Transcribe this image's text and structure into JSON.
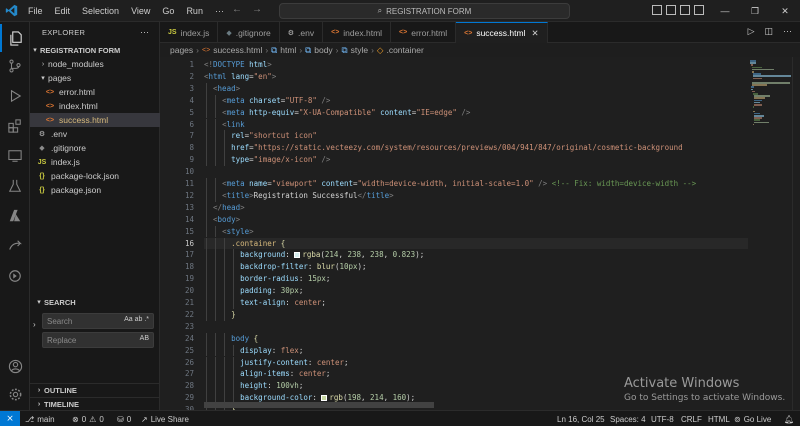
{
  "titlebar": {
    "menu": [
      "File",
      "Edit",
      "Selection",
      "View",
      "Go",
      "Run"
    ],
    "more": "···",
    "search_text": "REGISTRATION FORM"
  },
  "sidebar": {
    "explorer_label": "EXPLORER",
    "more": "···",
    "project_name": "REGISTRATION FORM",
    "tree": [
      {
        "label": "node_modules",
        "type": "folder",
        "collapsed": true
      },
      {
        "label": "pages",
        "type": "folder",
        "collapsed": false
      },
      {
        "label": "error.html",
        "type": "html"
      },
      {
        "label": "index.html",
        "type": "html"
      },
      {
        "label": "success.html",
        "type": "html",
        "selected": true
      },
      {
        "label": ".env",
        "type": "env"
      },
      {
        "label": ".gitignore",
        "type": "git"
      },
      {
        "label": "index.js",
        "type": "js",
        "icon": "JS"
      },
      {
        "label": "package-lock.json",
        "type": "json",
        "icon": "{}"
      },
      {
        "label": "package.json",
        "type": "json",
        "icon": "{}"
      }
    ],
    "search_label": "SEARCH",
    "search_placeholder": "Search",
    "search_opts": "Aa ab .*",
    "replace_placeholder": "Replace",
    "replace_opts": "AB",
    "outline_label": "OUTLINE",
    "timeline_label": "TIMELINE"
  },
  "tabs": [
    {
      "label": "index.js",
      "icon": "JS",
      "color": "#cbcb41"
    },
    {
      "label": ".gitignore",
      "icon": "◆",
      "color": "#41535b"
    },
    {
      "label": ".env",
      "icon": "⚙",
      "color": "#c5c5c5"
    },
    {
      "label": "index.html",
      "icon": "<>",
      "color": "#e37933"
    },
    {
      "label": "error.html",
      "icon": "<>",
      "color": "#e37933"
    },
    {
      "label": "success.html",
      "icon": "<>",
      "color": "#e37933",
      "active": true
    }
  ],
  "breadcrumb": [
    "pages",
    "success.html",
    "html",
    "body",
    "style",
    ".container"
  ],
  "editor": {
    "current_line": 16,
    "lines": [
      {
        "n": 1,
        "indent": 0,
        "parts": [
          [
            "pun",
            "<!"
          ],
          [
            "tag",
            "DOCTYPE"
          ],
          [
            "txt",
            " "
          ],
          [
            "attr",
            "html"
          ],
          [
            "pun",
            ">"
          ]
        ]
      },
      {
        "n": 2,
        "indent": 0,
        "parts": [
          [
            "pun",
            "<"
          ],
          [
            "tag",
            "html"
          ],
          [
            "txt",
            " "
          ],
          [
            "attr",
            "lang"
          ],
          [
            "txt",
            "="
          ],
          [
            "str",
            "\"en\""
          ],
          [
            "pun",
            ">"
          ]
        ]
      },
      {
        "n": 3,
        "indent": 2,
        "parts": [
          [
            "pun",
            "<"
          ],
          [
            "tag",
            "head"
          ],
          [
            "pun",
            ">"
          ]
        ]
      },
      {
        "n": 4,
        "indent": 4,
        "parts": [
          [
            "pun",
            "<"
          ],
          [
            "tag",
            "meta"
          ],
          [
            "txt",
            " "
          ],
          [
            "attr",
            "charset"
          ],
          [
            "txt",
            "="
          ],
          [
            "str",
            "\"UTF-8\""
          ],
          [
            "txt",
            " "
          ],
          [
            "pun",
            "/>"
          ]
        ]
      },
      {
        "n": 5,
        "indent": 4,
        "parts": [
          [
            "pun",
            "<"
          ],
          [
            "tag",
            "meta"
          ],
          [
            "txt",
            " "
          ],
          [
            "attr",
            "http-equiv"
          ],
          [
            "txt",
            "="
          ],
          [
            "str",
            "\"X-UA-Compatible\""
          ],
          [
            "txt",
            " "
          ],
          [
            "attr",
            "content"
          ],
          [
            "txt",
            "="
          ],
          [
            "str",
            "\"IE=edge\""
          ],
          [
            "txt",
            " "
          ],
          [
            "pun",
            "/>"
          ]
        ]
      },
      {
        "n": 6,
        "indent": 4,
        "parts": [
          [
            "pun",
            "<"
          ],
          [
            "tag",
            "link"
          ]
        ]
      },
      {
        "n": 7,
        "indent": 6,
        "parts": [
          [
            "attr",
            "rel"
          ],
          [
            "txt",
            "="
          ],
          [
            "str",
            "\"shortcut icon\""
          ]
        ]
      },
      {
        "n": 8,
        "indent": 6,
        "parts": [
          [
            "attr",
            "href"
          ],
          [
            "txt",
            "="
          ],
          [
            "str",
            "\"https://static.vecteezy.com/system/resources/previews/004/941/847/original/cosmetic-background"
          ]
        ]
      },
      {
        "n": 9,
        "indent": 6,
        "parts": [
          [
            "attr",
            "type"
          ],
          [
            "txt",
            "="
          ],
          [
            "str",
            "\"image/x-icon\""
          ],
          [
            "txt",
            " "
          ],
          [
            "pun",
            "/>"
          ]
        ]
      },
      {
        "n": 10,
        "indent": 0,
        "parts": []
      },
      {
        "n": 11,
        "indent": 4,
        "parts": [
          [
            "pun",
            "<"
          ],
          [
            "tag",
            "meta"
          ],
          [
            "txt",
            " "
          ],
          [
            "attr",
            "name"
          ],
          [
            "txt",
            "="
          ],
          [
            "str",
            "\"viewport\""
          ],
          [
            "txt",
            " "
          ],
          [
            "attr",
            "content"
          ],
          [
            "txt",
            "="
          ],
          [
            "str",
            "\"width=device-width, initial-scale=1.0\""
          ],
          [
            "txt",
            " "
          ],
          [
            "pun",
            "/>"
          ],
          [
            "txt",
            " "
          ],
          [
            "cmt",
            "<!-- Fix: width=device-width -->"
          ]
        ]
      },
      {
        "n": 12,
        "indent": 4,
        "parts": [
          [
            "pun",
            "<"
          ],
          [
            "tag",
            "title"
          ],
          [
            "pun",
            ">"
          ],
          [
            "txt",
            "Registration Successful"
          ],
          [
            "pun",
            "</"
          ],
          [
            "tag",
            "title"
          ],
          [
            "pun",
            ">"
          ]
        ]
      },
      {
        "n": 13,
        "indent": 2,
        "parts": [
          [
            "pun",
            "</"
          ],
          [
            "tag",
            "head"
          ],
          [
            "pun",
            ">"
          ]
        ]
      },
      {
        "n": 14,
        "indent": 2,
        "parts": [
          [
            "pun",
            "<"
          ],
          [
            "tag",
            "body"
          ],
          [
            "pun",
            ">"
          ]
        ]
      },
      {
        "n": 15,
        "indent": 4,
        "parts": [
          [
            "pun",
            "<"
          ],
          [
            "tag",
            "style"
          ],
          [
            "pun",
            ">"
          ]
        ]
      },
      {
        "n": 16,
        "indent": 6,
        "parts": [
          [
            "sel",
            ".container"
          ],
          [
            "txt",
            " "
          ],
          [
            "fn",
            "{"
          ]
        ]
      },
      {
        "n": 17,
        "indent": 8,
        "parts": [
          [
            "prop",
            "background"
          ],
          [
            "txt",
            ": "
          ],
          [
            "swatch",
            "#d6eeee"
          ],
          [
            "fn",
            "rgba"
          ],
          [
            "txt",
            "("
          ],
          [
            "num",
            "214"
          ],
          [
            "txt",
            ", "
          ],
          [
            "num",
            "238"
          ],
          [
            "txt",
            ", "
          ],
          [
            "num",
            "238"
          ],
          [
            "txt",
            ", "
          ],
          [
            "num",
            "0.823"
          ],
          [
            "txt",
            ");"
          ]
        ]
      },
      {
        "n": 18,
        "indent": 8,
        "parts": [
          [
            "prop",
            "backdrop-filter"
          ],
          [
            "txt",
            ": "
          ],
          [
            "fn",
            "blur"
          ],
          [
            "txt",
            "("
          ],
          [
            "num",
            "10px"
          ],
          [
            "txt",
            ");"
          ]
        ]
      },
      {
        "n": 19,
        "indent": 8,
        "parts": [
          [
            "prop",
            "border-radius"
          ],
          [
            "txt",
            ": "
          ],
          [
            "num",
            "15px"
          ],
          [
            "txt",
            ";"
          ]
        ]
      },
      {
        "n": 20,
        "indent": 8,
        "parts": [
          [
            "prop",
            "padding"
          ],
          [
            "txt",
            ": "
          ],
          [
            "num",
            "30px"
          ],
          [
            "txt",
            ";"
          ]
        ]
      },
      {
        "n": 21,
        "indent": 8,
        "parts": [
          [
            "prop",
            "text-align"
          ],
          [
            "txt",
            ": "
          ],
          [
            "str",
            "center"
          ],
          [
            "txt",
            ";"
          ]
        ]
      },
      {
        "n": 22,
        "indent": 6,
        "parts": [
          [
            "fn",
            "}"
          ]
        ]
      },
      {
        "n": 23,
        "indent": 0,
        "parts": []
      },
      {
        "n": 24,
        "indent": 6,
        "parts": [
          [
            "tag",
            "body"
          ],
          [
            "txt",
            " "
          ],
          [
            "fn",
            "{"
          ]
        ]
      },
      {
        "n": 25,
        "indent": 8,
        "parts": [
          [
            "prop",
            "display"
          ],
          [
            "txt",
            ": "
          ],
          [
            "str",
            "flex"
          ],
          [
            "txt",
            ";"
          ]
        ]
      },
      {
        "n": 26,
        "indent": 8,
        "parts": [
          [
            "prop",
            "justify-content"
          ],
          [
            "txt",
            ": "
          ],
          [
            "str",
            "center"
          ],
          [
            "txt",
            ";"
          ]
        ]
      },
      {
        "n": 27,
        "indent": 8,
        "parts": [
          [
            "prop",
            "align-items"
          ],
          [
            "txt",
            ": "
          ],
          [
            "str",
            "center"
          ],
          [
            "txt",
            ";"
          ]
        ]
      },
      {
        "n": 28,
        "indent": 8,
        "parts": [
          [
            "prop",
            "height"
          ],
          [
            "txt",
            ": "
          ],
          [
            "num",
            "100vh"
          ],
          [
            "txt",
            ";"
          ]
        ]
      },
      {
        "n": 29,
        "indent": 8,
        "parts": [
          [
            "prop",
            "background-color"
          ],
          [
            "txt",
            ": "
          ],
          [
            "swatch",
            "#c6d6a0"
          ],
          [
            "fn",
            "rgb"
          ],
          [
            "txt",
            "("
          ],
          [
            "num",
            "198"
          ],
          [
            "txt",
            ", "
          ],
          [
            "num",
            "214"
          ],
          [
            "txt",
            ", "
          ],
          [
            "num",
            "160"
          ],
          [
            "txt",
            ");"
          ]
        ]
      },
      {
        "n": 30,
        "indent": 6,
        "parts": [
          [
            "fn",
            "}"
          ]
        ]
      }
    ]
  },
  "watermark": {
    "line1": "Activate Windows",
    "line2": "Go to Settings to activate Windows."
  },
  "status": {
    "branch": "main",
    "errors": "0",
    "warnings": "0",
    "ports": "0",
    "live_share": "Live Share",
    "position": "Ln 16, Col 25",
    "spaces": "Spaces: 4",
    "encoding": "UTF-8",
    "eol": "CRLF",
    "language": "HTML",
    "go_live": "Go Live"
  },
  "colors": {
    "accent": "#0078d4",
    "editor_bg": "#1f1f1f",
    "sidebar_bg": "#181818"
  }
}
